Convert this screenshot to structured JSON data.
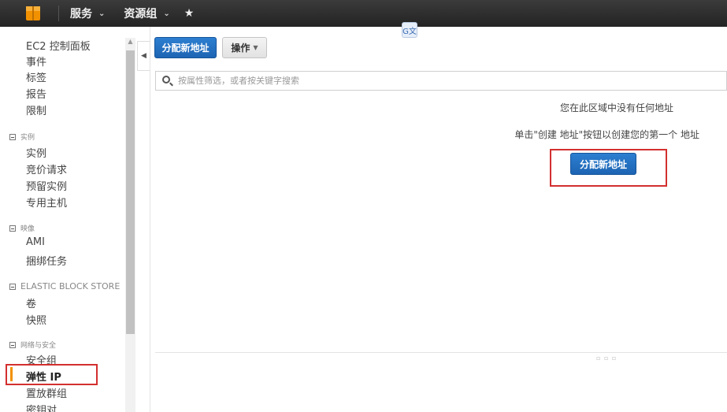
{
  "topbar": {
    "services_label": "服务",
    "resource_groups_label": "资源组",
    "chevron": "⌄",
    "pin_icon": "★"
  },
  "sidebar": {
    "items": [
      {
        "label": "EC2 控制面板"
      },
      {
        "label": "事件"
      },
      {
        "label": "标签"
      },
      {
        "label": "报告"
      },
      {
        "label": "限制"
      }
    ],
    "sections": [
      {
        "header": "实例",
        "items": [
          "实例",
          "竞价请求",
          "预留实例",
          "专用主机"
        ]
      },
      {
        "header": "映像",
        "items": [
          "AMI",
          "捆绑任务"
        ]
      },
      {
        "header": "ELASTIC BLOCK STORE",
        "items": [
          "卷",
          "快照"
        ]
      },
      {
        "header": "网络与安全",
        "items": [
          "安全组",
          "弹性 IP",
          "置放群组",
          "密钥对"
        ]
      }
    ],
    "active_item": "弹性 IP"
  },
  "main": {
    "allocate_button": "分配新地址",
    "actions_button": "操作",
    "filter_placeholder": "按属性筛选，或者按关键字搜索",
    "empty_message": "您在此区域中没有任何地址",
    "empty_hint": "单击\"创建 地址\"按钮以创建您的第一个 地址",
    "allocate_center_button": "分配新地址"
  },
  "colors": {
    "accent_blue": "#1d64b3",
    "highlight_red": "#d32f2f",
    "active_orange": "#f29100"
  }
}
